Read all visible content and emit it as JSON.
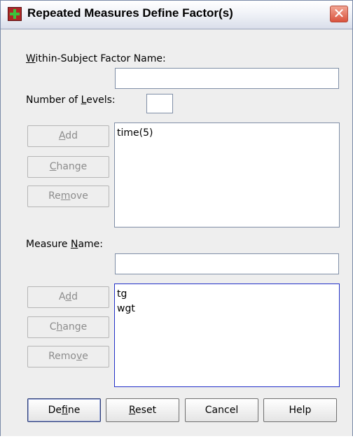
{
  "window": {
    "title": "Repeated Measures Define Factor(s)",
    "close_glyph": "✕"
  },
  "within_subject": {
    "label_mnemonic": "W",
    "label_rest": "ithin-Subject Factor Name:",
    "value": ""
  },
  "levels": {
    "label_pre": "Number of ",
    "label_mnemonic": "L",
    "label_post": "evels:",
    "value": ""
  },
  "factor_buttons": {
    "add": {
      "pre": "",
      "mn": "A",
      "post": "dd"
    },
    "change": {
      "pre": "",
      "mn": "C",
      "post": "hange"
    },
    "remove": {
      "pre": "Re",
      "mn": "m",
      "post": "ove"
    }
  },
  "factor_list": [
    "time(5)"
  ],
  "measure": {
    "label_pre": "Measure ",
    "label_mnemonic": "N",
    "label_post": "ame:",
    "value": ""
  },
  "measure_buttons": {
    "add": {
      "pre": "A",
      "mn": "d",
      "post": "d"
    },
    "change": {
      "pre": "C",
      "mn": "h",
      "post": "ange"
    },
    "remove": {
      "pre": "Remo",
      "mn": "v",
      "post": "e"
    }
  },
  "measure_list": [
    "tg",
    "wgt"
  ],
  "footer_buttons": {
    "define": {
      "pre": "De",
      "mn": "f",
      "post": "ine"
    },
    "reset": {
      "pre": "",
      "mn": "R",
      "post": "eset"
    },
    "cancel": "Cancel",
    "help": "Help"
  },
  "colors": {
    "dialog_bg": "#eeeeee",
    "focus_border": "#2230c8",
    "disabled_text": "#8c8c8c",
    "close_button": "#d9523d"
  }
}
